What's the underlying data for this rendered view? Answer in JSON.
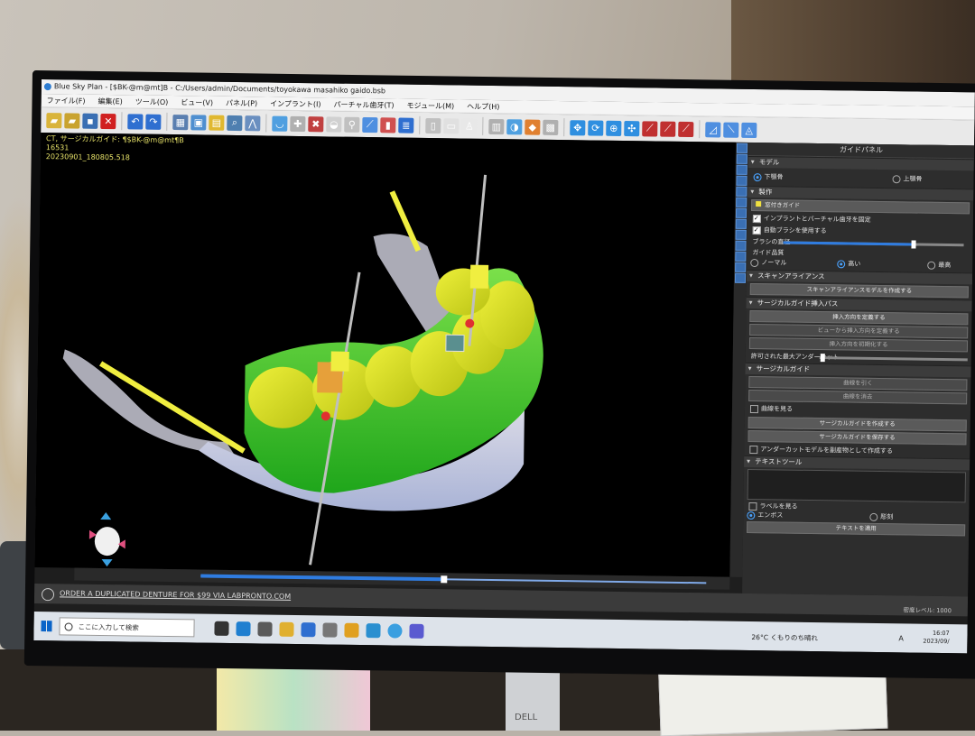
{
  "window": {
    "title": "Blue Sky Plan - [$BK-@m@mt]B - C:/Users/admin/Documents/toyokawa masahiko gaido.bsb"
  },
  "menu": [
    "ファイル(F)",
    "編集(E)",
    "ツール(O)",
    "ビュー(V)",
    "パネル(P)",
    "インプラント(I)",
    "パーチャル歯牙(T)",
    "モジュール(M)",
    "ヘルプ(H)"
  ],
  "viewport": {
    "info_lines": [
      "CT, サージカルガイド: ¶$BK-@m@mt¶B",
      "16531",
      "20230901_180805.518"
    ]
  },
  "panel": {
    "title": "ガイドパネル",
    "model": {
      "header": "モデル",
      "options": [
        "下顎骨",
        "上顎骨"
      ],
      "selected": "下顎骨"
    },
    "create": {
      "header": "製作",
      "guide_label": "窓付きガイド",
      "check_fix": "インプラントとバーチャル歯牙を固定",
      "check_brush": "自動ブラシを使用する",
      "brush_label": "ブラシの直径",
      "brush_value": 0.72,
      "quality_label": "ガイド品質",
      "quality_options": [
        "ノーマル",
        "高い",
        "最高"
      ],
      "quality_selected": "高い"
    },
    "scan": {
      "header": "スキャンアライアンス",
      "button": "スキャンアライアンスモデルを作成する"
    },
    "path": {
      "header": "サージカルガイド挿入パス",
      "buttons": [
        "挿入方向を定義する",
        "ビューから挿入方向を定義する",
        "挿入方向を初期化する"
      ],
      "undercut_label": "許可された最大アンダーカット",
      "undercut_value": 0.02
    },
    "guide": {
      "header": "サージカルガイド",
      "buttons_top": [
        "曲線を引く",
        "曲線を消去"
      ],
      "check_curve": "曲線を見る",
      "buttons_bottom": [
        "サージカルガイドを作成する",
        "サージカルガイドを保存する"
      ],
      "check_undercut": "アンダーカットモデルを副産物として作成する"
    },
    "text": {
      "header": "テキストツール",
      "check_label": "ラベルを見る",
      "options": [
        "エンボス",
        "彫刻"
      ],
      "selected": "エンボス",
      "apply": "テキストを適用"
    }
  },
  "adbar": {
    "message": "ORDER A DUPLICATED DENTURE FOR $99 VIA LABPRONTO.COM",
    "density": "密度レベル: 1000"
  },
  "taskbar": {
    "search_placeholder": "ここに入力して検索",
    "weather": "26°C くもりのち晴れ",
    "ime": "A",
    "time": "16:07",
    "date": "2023/09/"
  },
  "colors": {
    "accent": "#2f7ce0",
    "guide_green": "#22c21e",
    "teeth_yellow": "#d8e020",
    "panel_bg": "#2d2d2d"
  }
}
